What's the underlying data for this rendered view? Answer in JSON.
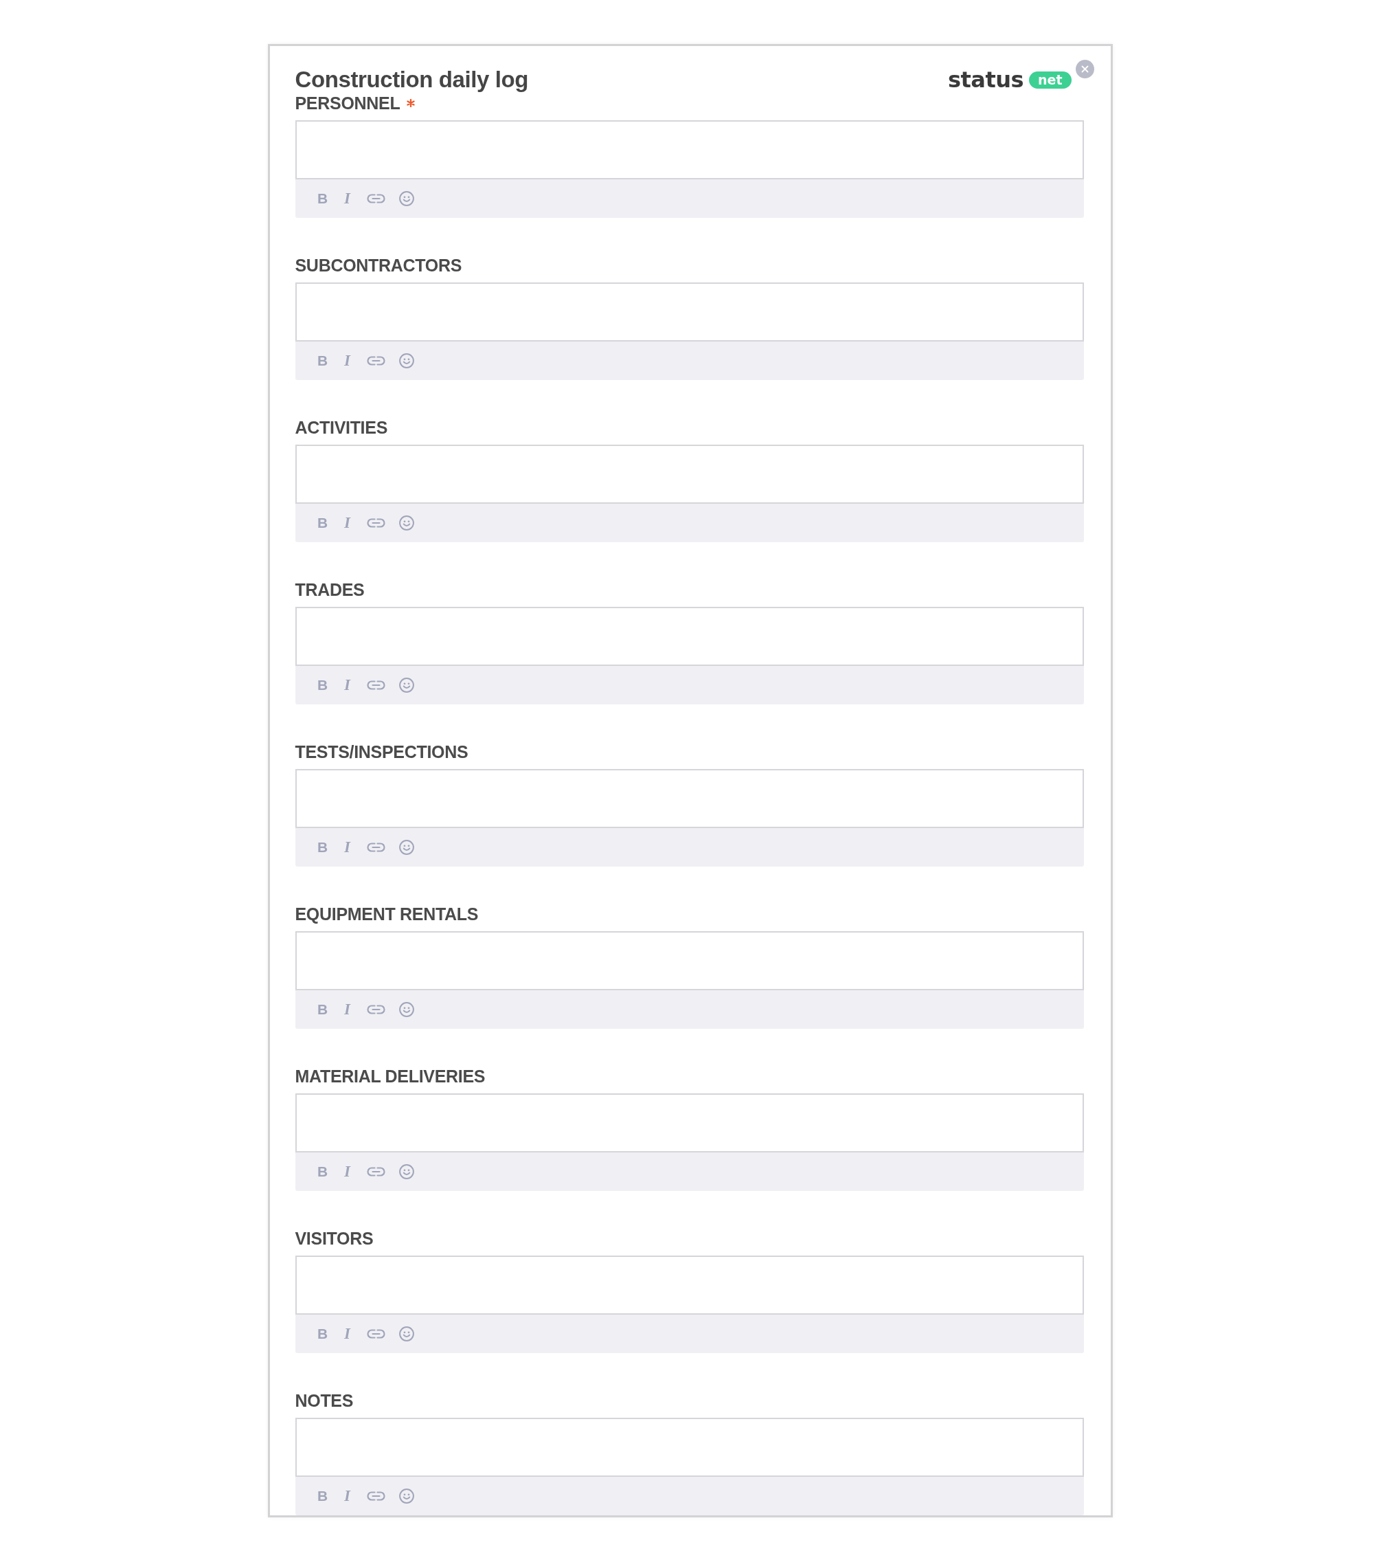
{
  "form": {
    "title": "Construction daily log",
    "logo": {
      "wordmark": "status",
      "badge": "net"
    }
  },
  "sections": [
    {
      "label": "PERSONNEL",
      "required": true,
      "toolbar": [
        {
          "kind": "bold",
          "label": "B"
        },
        {
          "kind": "italic",
          "label": "I"
        },
        {
          "kind": "link"
        },
        {
          "kind": "emoji"
        }
      ]
    },
    {
      "label": "SUBCONTRACTORS",
      "required": false,
      "toolbar": [
        {
          "kind": "bold",
          "label": "B"
        },
        {
          "kind": "italic",
          "label": "I"
        },
        {
          "kind": "link"
        },
        {
          "kind": "emoji"
        }
      ]
    },
    {
      "label": "ACTIVITIES",
      "required": false,
      "toolbar": [
        {
          "kind": "bold",
          "label": "B"
        },
        {
          "kind": "italic",
          "label": "I"
        },
        {
          "kind": "link"
        },
        {
          "kind": "emoji"
        }
      ]
    },
    {
      "label": "TRADES",
      "required": false,
      "toolbar": [
        {
          "kind": "bold",
          "label": "B"
        },
        {
          "kind": "italic",
          "label": "I"
        },
        {
          "kind": "link"
        },
        {
          "kind": "emoji"
        }
      ]
    },
    {
      "label": "TESTS/INSPECTIONS",
      "required": false,
      "toolbar": [
        {
          "kind": "bold",
          "label": "B"
        },
        {
          "kind": "italic",
          "label": "I"
        },
        {
          "kind": "link"
        },
        {
          "kind": "emoji"
        }
      ]
    },
    {
      "label": "EQUIPMENT RENTALS",
      "required": false,
      "toolbar": [
        {
          "kind": "bold",
          "label": "B"
        },
        {
          "kind": "italic",
          "label": "I"
        },
        {
          "kind": "link"
        },
        {
          "kind": "emoji"
        }
      ]
    },
    {
      "label": "MATERIAL DELIVERIES",
      "required": false,
      "toolbar": [
        {
          "kind": "bold",
          "label": "B"
        },
        {
          "kind": "italic",
          "label": "I"
        },
        {
          "kind": "link"
        },
        {
          "kind": "emoji"
        }
      ]
    },
    {
      "label": "VISITORS",
      "required": false,
      "toolbar": [
        {
          "kind": "bold",
          "label": "B"
        },
        {
          "kind": "italic",
          "label": "I"
        },
        {
          "kind": "link"
        },
        {
          "kind": "emoji"
        }
      ]
    },
    {
      "label": "NOTES",
      "required": false,
      "toolbar": [
        {
          "kind": "bold",
          "label": "B"
        },
        {
          "kind": "italic",
          "label": "I"
        },
        {
          "kind": "link"
        },
        {
          "kind": "emoji"
        }
      ]
    }
  ]
}
